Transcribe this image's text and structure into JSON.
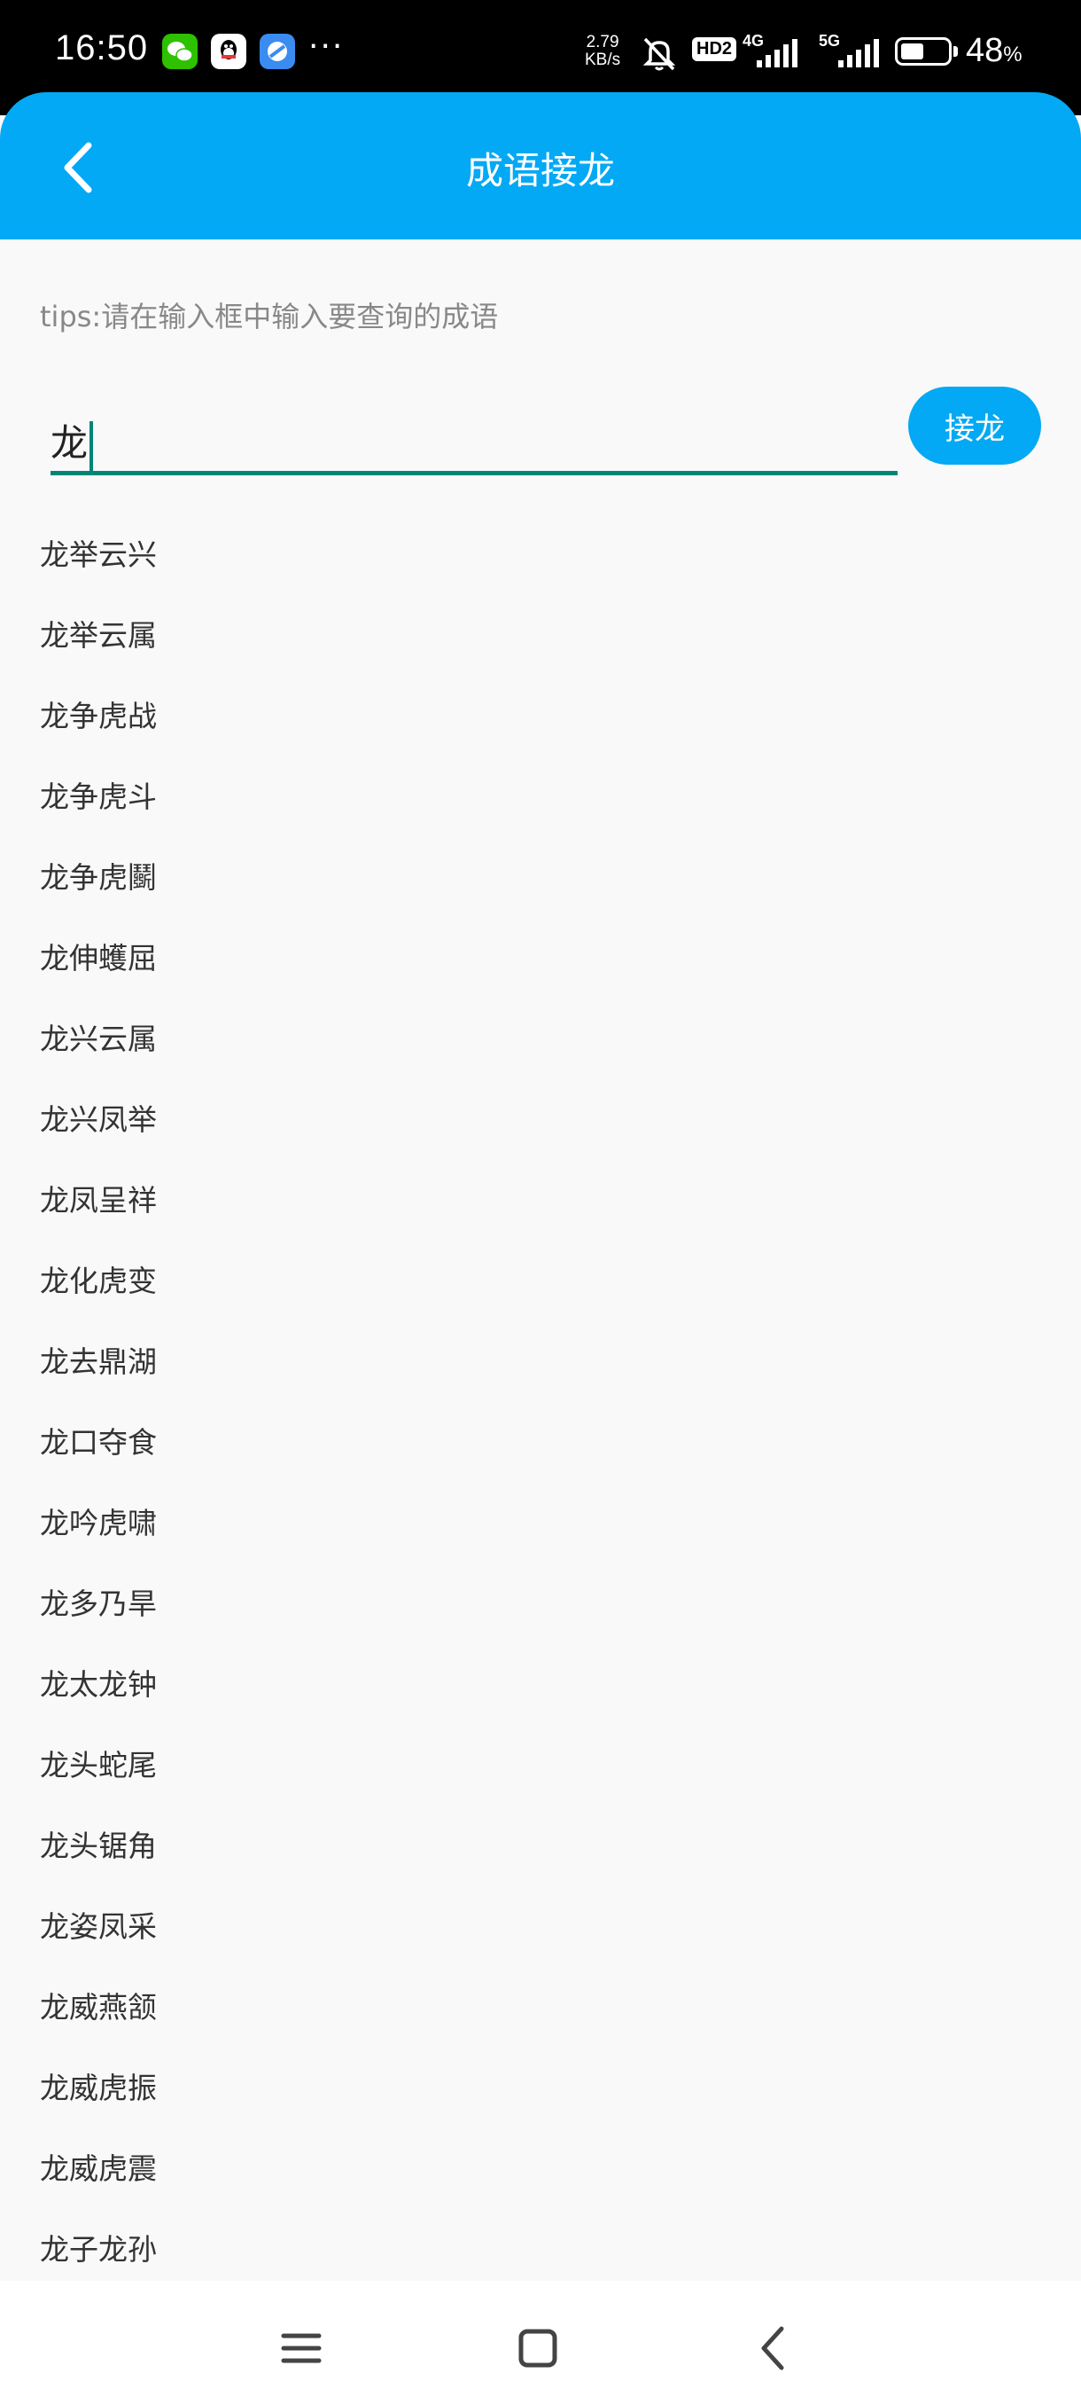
{
  "status_bar": {
    "time": "16:50",
    "more": "···",
    "net_speed_value": "2.79",
    "net_speed_unit": "KB/s",
    "hd_label": "HD2",
    "net_4g": "4G",
    "net_5g": "5G",
    "battery_number": "48",
    "battery_unit": "%",
    "battery_level": 0.48,
    "icons": [
      "wechat-icon",
      "qq-icon",
      "browser-icon",
      "mute-bell-icon",
      "signal-icon",
      "battery-icon"
    ]
  },
  "header": {
    "title": "成语接龙",
    "back_icon": "chevron-left-icon",
    "color": "#03a9f4"
  },
  "tips": "tips:请在输入框中输入要查询的成语",
  "search": {
    "value": "龙",
    "button_label": "接龙",
    "accent": "#008577"
  },
  "results": [
    "龙举云兴",
    "龙举云属",
    "龙争虎战",
    "龙争虎斗",
    "龙争虎鬬",
    "龙伸蠖屈",
    "龙兴云属",
    "龙兴凤举",
    "龙凤呈祥",
    "龙化虎变",
    "龙去鼎湖",
    "龙口夺食",
    "龙吟虎啸",
    "龙多乃旱",
    "龙太龙钟",
    "龙头蛇尾",
    "龙头锯角",
    "龙姿凤采",
    "龙威燕颔",
    "龙威虎振",
    "龙威虎震",
    "龙子龙孙"
  ],
  "nav_bar": {
    "menu_icon": "menu-icon",
    "home_icon": "home-icon",
    "back_icon": "back-icon"
  }
}
